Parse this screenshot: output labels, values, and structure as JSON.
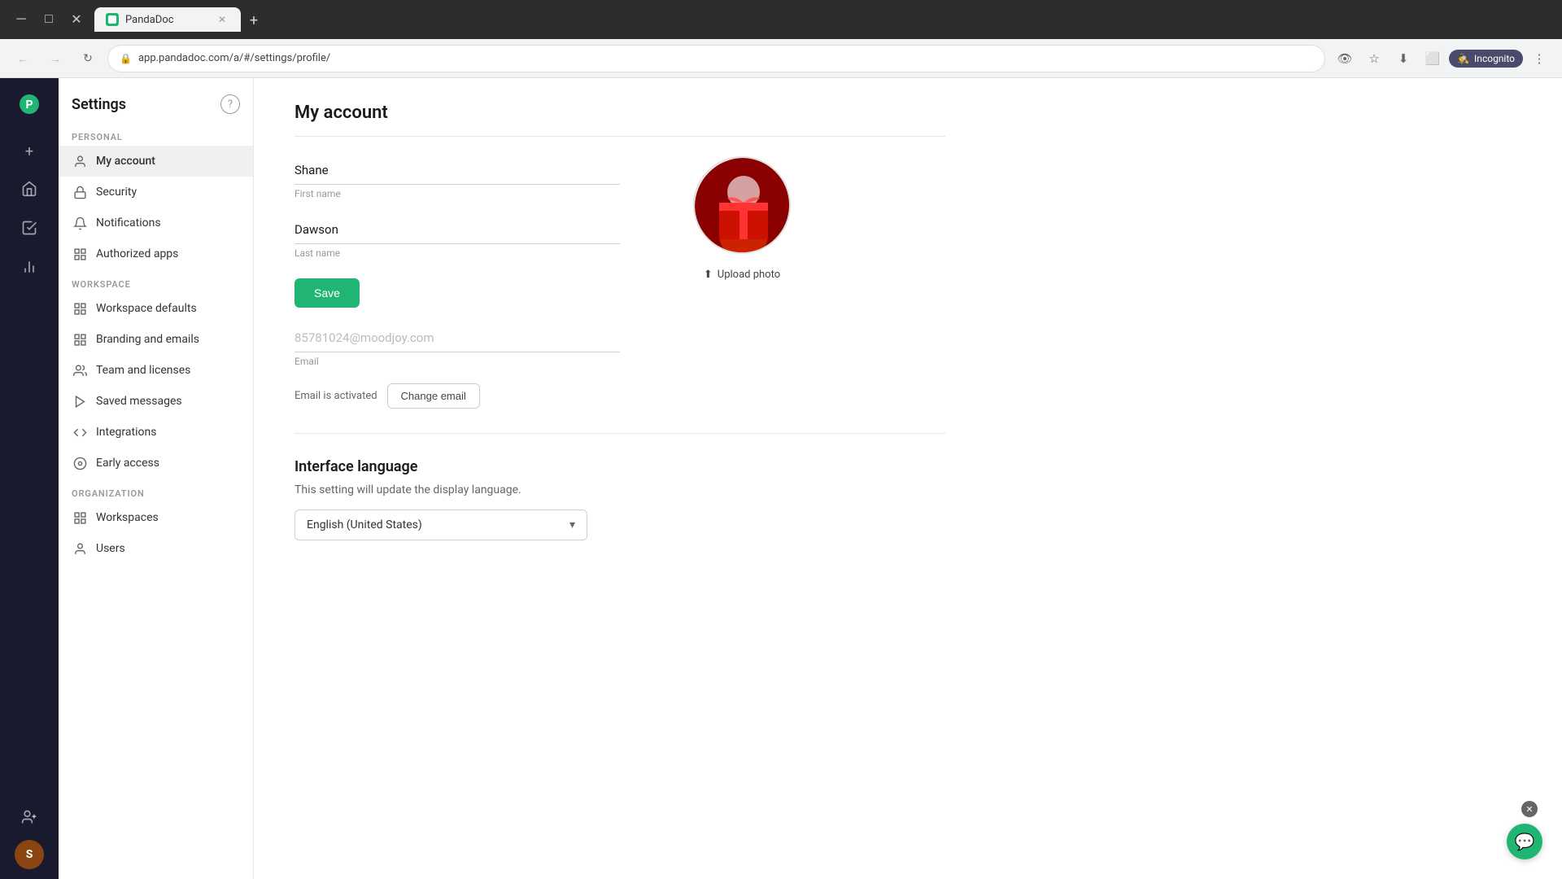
{
  "browser": {
    "tab_title": "PandaDoc",
    "url": "app.pandadoc.com/a/#/settings/profile/",
    "new_tab_label": "+",
    "incognito_label": "Incognito"
  },
  "sidebar": {
    "title": "Settings",
    "help_label": "?",
    "sections": [
      {
        "label": "PERSONAL",
        "items": [
          {
            "id": "my-account",
            "label": "My account",
            "icon": "person",
            "active": true
          },
          {
            "id": "security",
            "label": "Security",
            "icon": "lock"
          },
          {
            "id": "notifications",
            "label": "Notifications",
            "icon": "bell"
          },
          {
            "id": "authorized-apps",
            "label": "Authorized apps",
            "icon": "grid"
          }
        ]
      },
      {
        "label": "WORKSPACE",
        "items": [
          {
            "id": "workspace-defaults",
            "label": "Workspace defaults",
            "icon": "grid"
          },
          {
            "id": "branding-emails",
            "label": "Branding and emails",
            "icon": "grid"
          },
          {
            "id": "team-licenses",
            "label": "Team and licenses",
            "icon": "people"
          },
          {
            "id": "saved-messages",
            "label": "Saved messages",
            "icon": "arrow"
          },
          {
            "id": "integrations",
            "label": "Integrations",
            "icon": "code"
          },
          {
            "id": "early-access",
            "label": "Early access",
            "icon": "circle"
          }
        ]
      },
      {
        "label": "ORGANIZATION",
        "items": [
          {
            "id": "workspaces",
            "label": "Workspaces",
            "icon": "grid"
          },
          {
            "id": "users",
            "label": "Users",
            "icon": "person"
          }
        ]
      }
    ]
  },
  "my_account": {
    "title": "My account",
    "first_name_value": "Shane",
    "first_name_label": "First name",
    "last_name_value": "Dawson",
    "last_name_label": "Last name",
    "save_button": "Save",
    "email_value": "85781024@moodjoy.com",
    "email_label": "Email",
    "email_activated_text": "Email is activated",
    "change_email_button": "Change email",
    "upload_photo_label": "Upload photo"
  },
  "interface_language": {
    "title": "Interface language",
    "description": "This setting will update the display language.",
    "selected_language": "English (United States)"
  },
  "icon_bar": {
    "items": [
      {
        "id": "plus",
        "icon": "+"
      },
      {
        "id": "home",
        "icon": "⌂"
      },
      {
        "id": "check",
        "icon": "✓"
      },
      {
        "id": "chart",
        "icon": "▦"
      }
    ]
  }
}
